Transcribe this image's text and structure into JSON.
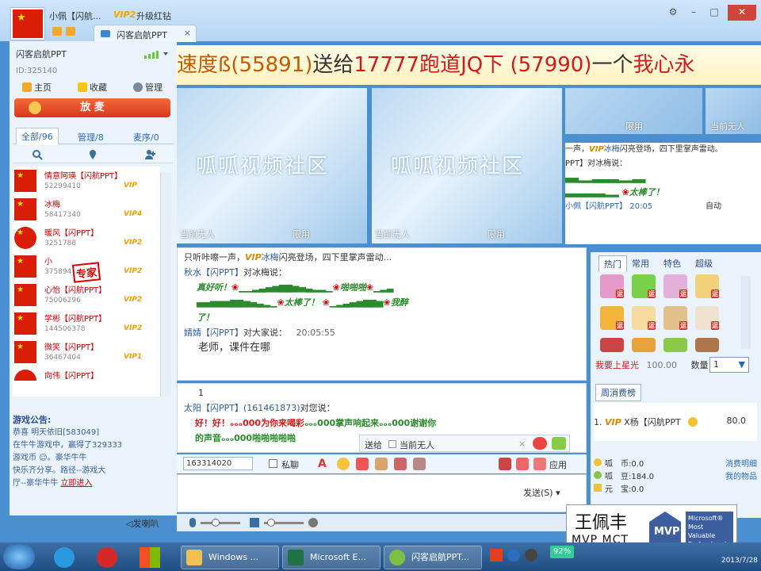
{
  "window": {
    "username": "小佩【闪航...",
    "vip_level": "VIP2",
    "upgrade_label": "升级红钻",
    "tab_label": "闪客启航PPT",
    "tab_close": "×",
    "btn_settings": "⚙",
    "btn_min": "–",
    "btn_max": "□",
    "btn_close": "✕"
  },
  "room": {
    "name": "闪客启航PPT",
    "id": "ID:325140",
    "nav": [
      "主页",
      "收藏",
      "管理"
    ],
    "mic_button": "放 麦",
    "tabs": [
      "全部/96",
      "管理/8",
      "麦序/0"
    ]
  },
  "users": [
    {
      "name": "情意阿瑛【闪航PPT】",
      "id": "52299410",
      "vip": "VIP"
    },
    {
      "name": "冰梅",
      "id": "58417340",
      "vip": "VIP4"
    },
    {
      "name": "暖风【闪PPT】",
      "id": "3251788",
      "vip": "VIP2"
    },
    {
      "name": "小",
      "id": "375894",
      "vip": "VIP2"
    },
    {
      "name": "心怡【闪航PPT】",
      "id": "75006296",
      "vip": "VIP2"
    },
    {
      "name": "学彬【闪航PPT】",
      "id": "144506378",
      "vip": "VIP2"
    },
    {
      "name": "微笑【闪PPT】",
      "id": "36467404",
      "vip": "VIP1"
    },
    {
      "name": "向伟【闪PPT】",
      "id": "",
      "vip": ""
    }
  ],
  "expert_stamp": "专家",
  "notice": {
    "title": "游戏公告:",
    "line1": "恭喜 明天依旧[583049]",
    "line2": "在牛牛游戏中，赢得了329333",
    "line3": "游戏币",
    "line4": "。豪华牛牛",
    "line5": "快乐齐分享。路径--游戏大",
    "line6": "厅--豪华牛牛",
    "link": "立即进入"
  },
  "broadcast": {
    "part1": "速度ß(55891)",
    "part2": "送给",
    "part3": "17777跑道JQ下 (57990)",
    "part4": "一个",
    "part5": "我心永"
  },
  "videos": {
    "watermark": "呱呱视频社区",
    "status_empty": "当前无人",
    "limit": "限用",
    "auto": "自动"
  },
  "public_top": {
    "line1": "一声，",
    "line1_name": "冰梅",
    "line1_rest": "闪亮登场，四下里掌声雷动。",
    "line2": "PPT】对冰梅说：",
    "line3": "太棒了！",
    "line4": "小佩【闪航PPT】 20:05"
  },
  "chat": {
    "line0": "只听咔嚓一声，",
    "line0_name": "冰梅",
    "line0_rest": "闪亮登场，四下里掌声雷动...",
    "line1_sender": "秋水【闪PPT】",
    "line1_to": "对冰梅说：",
    "line2": "真好听！",
    "line2b": "啪啪啪",
    "line3": "太棒了！",
    "line3b": "我醉",
    "line4": "了！",
    "line5_sender": "婧婧【闪PPT】",
    "line5_to": "对大家说：",
    "line5_time": "20:05:55",
    "line6": "老师，课件在哪"
  },
  "private_chat": {
    "line0": "1",
    "line1_sender": "太阳【闪PPT】",
    "line1_id": "(161461873)",
    "line1_to": "对您说：",
    "line2_a": "好！好！",
    "line2_b": "为你来喝彩",
    "line2_c": "掌声响起来",
    "line2_d": "谢谢你",
    "line3_a": "的声音",
    "line3_b": "啪啪啪啪啪"
  },
  "send_to": {
    "label": "送给",
    "value": "当前无人"
  },
  "toolbar": {
    "id_value": "163314020",
    "private_label": "私聊",
    "apply_label": "应用",
    "send_label": "发送(S)"
  },
  "gifts": {
    "tabs": [
      "热门",
      "常用",
      "特色",
      "超级"
    ],
    "badge": "运",
    "star_label": "我要上星光",
    "star_value": "100.00",
    "qty_label": "数量",
    "qty_value": "1",
    "week_tab": "周消费榜",
    "rank_num": "1.",
    "rank_vip": "VIP",
    "rank_name": "X杨【闪航PPT",
    "rank_value": "80.0"
  },
  "coins": {
    "coin_label": "呱　币:0.0",
    "bean_label": "呱　豆:184.0",
    "yuan_label": "元　宝:0.0",
    "detail_link": "消费明细",
    "goods_link": "我的物品"
  },
  "audio": {
    "speaker_label": "发喇叭"
  },
  "mvp": {
    "name": "王佩丰",
    "title": "MVP MCT",
    "logo_text": "MVP",
    "ms_text": "Microsoft® Most Valuable Professional"
  },
  "taskbar": {
    "items": [
      "Windows ...",
      "Microsoft E...",
      "闪客启航PPT..."
    ],
    "zoom": "92%",
    "date": "2013/7/28"
  }
}
